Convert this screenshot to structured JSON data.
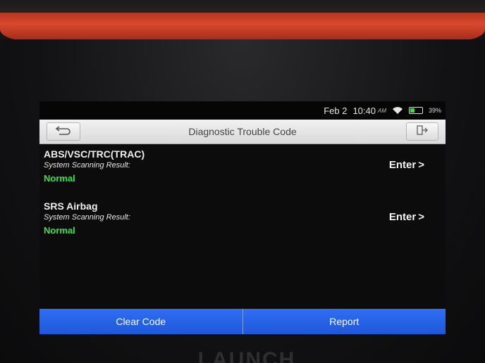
{
  "status_bar": {
    "date": "Feb 2",
    "time": "10:40",
    "ampm": "AM",
    "battery": "39%",
    "battery_level": 0.39
  },
  "header": {
    "title": "Diagnostic Trouble Code"
  },
  "systems": [
    {
      "name": "ABS/VSC/TRC(TRAC)",
      "caption": "System Scanning Result:",
      "status": "Normal",
      "enter_label": "Enter",
      "enter_chevron": ">"
    },
    {
      "name": "SRS Airbag",
      "caption": "System Scanning Result:",
      "status": "Normal",
      "enter_label": "Enter",
      "enter_chevron": ">"
    }
  ],
  "bottom_bar": {
    "clear_code": "Clear Code",
    "report": "Report"
  },
  "device": {
    "brand": "LAUNCH"
  },
  "colors": {
    "status_normal": "#33e64a",
    "button_blue": "#2f6ef4",
    "bezel_red": "#d8492e"
  },
  "icons": {
    "back": "back-arrow-icon",
    "exit": "exit-icon",
    "wifi": "wifi-icon",
    "battery": "battery-icon"
  }
}
